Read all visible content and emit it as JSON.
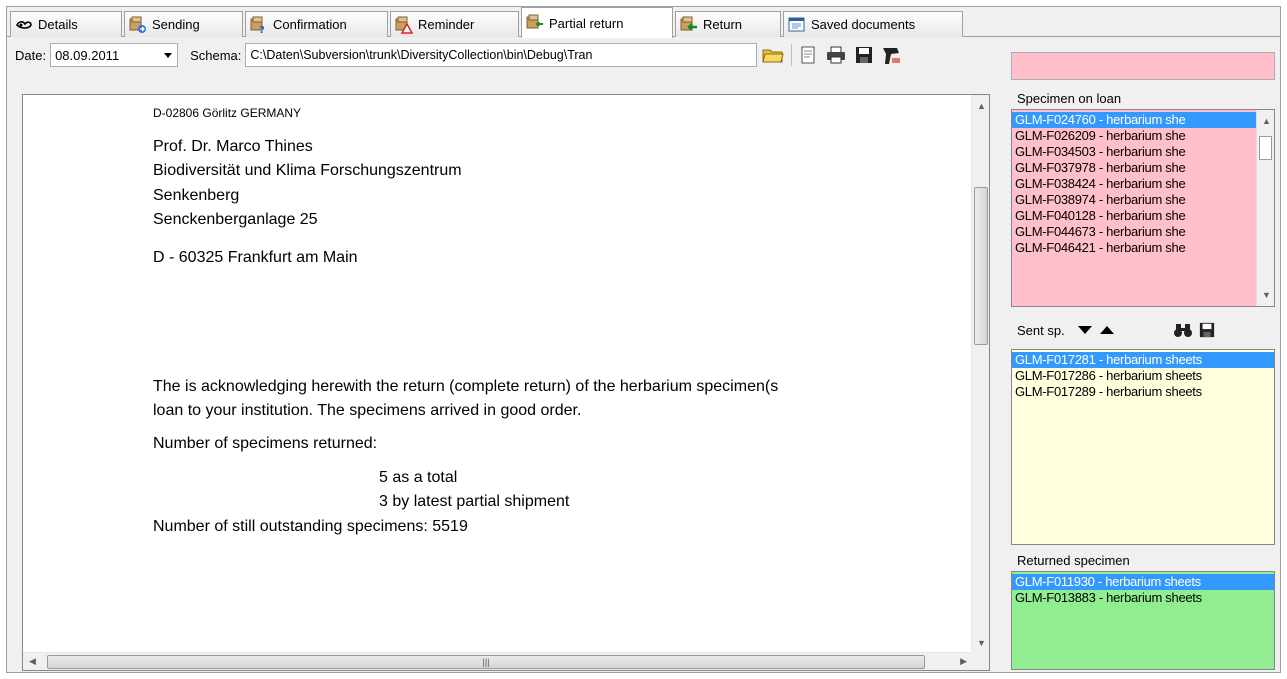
{
  "tabs": [
    {
      "label": "Details",
      "icon": "details-icon"
    },
    {
      "label": "Sending",
      "icon": "sending-icon"
    },
    {
      "label": "Confirmation",
      "icon": "confirmation-icon"
    },
    {
      "label": "Reminder",
      "icon": "reminder-icon"
    },
    {
      "label": "Partial return",
      "icon": "partial-return-icon",
      "active": true
    },
    {
      "label": "Return",
      "icon": "return-icon"
    },
    {
      "label": "Saved documents",
      "icon": "saved-documents-icon"
    }
  ],
  "toolbar": {
    "date_label": "Date:",
    "date_value": "08.09.2011",
    "schema_label": "Schema:",
    "schema_value": "C:\\Daten\\Subversion\\trunk\\DiversityCollection\\bin\\Debug\\Tran"
  },
  "document": {
    "sender_line": "D-02806 Görlitz GERMANY",
    "recipient": [
      "Prof. Dr. Marco Thines",
      "Biodiversität und Klima Forschungszentrum",
      "Senkenberg",
      "Senckenberganlage 25"
    ],
    "city": "D - 60325 Frankfurt am Main",
    "body_line1": "The is acknowledging herewith the return (complete return) of the herbarium specimen(s",
    "body_line2": "loan to your institution. The specimens arrived in good order.",
    "returned_label": "Number of specimens returned:",
    "total_line": "5 as a total",
    "partial_line": "3 by latest partial shipment",
    "outstanding_line": "Number of still outstanding specimens: 5519"
  },
  "specimen_on_loan": {
    "label": "Specimen on loan",
    "items": [
      "GLM-F024760 - herbarium she",
      "GLM-F026209 - herbarium she",
      "GLM-F034503 - herbarium she",
      "GLM-F037978 - herbarium she",
      "GLM-F038424 - herbarium she",
      "GLM-F038974 - herbarium she",
      "GLM-F040128 - herbarium she",
      "GLM-F044673 - herbarium she",
      "GLM-F046421 - herbarium she"
    ]
  },
  "sent": {
    "label": "Sent sp.",
    "items": [
      "GLM-F017281 - herbarium sheets",
      "GLM-F017286 - herbarium sheets",
      "GLM-F017289 - herbarium sheets"
    ]
  },
  "returned_specimen": {
    "label": "Returned specimen",
    "items": [
      "GLM-F011930 - herbarium sheets",
      "GLM-F013883 - herbarium sheets"
    ]
  },
  "colors": {
    "pink": "#ffc0cb",
    "yellow": "#ffffe0",
    "green": "#90ee90",
    "selection": "#3399ff"
  }
}
